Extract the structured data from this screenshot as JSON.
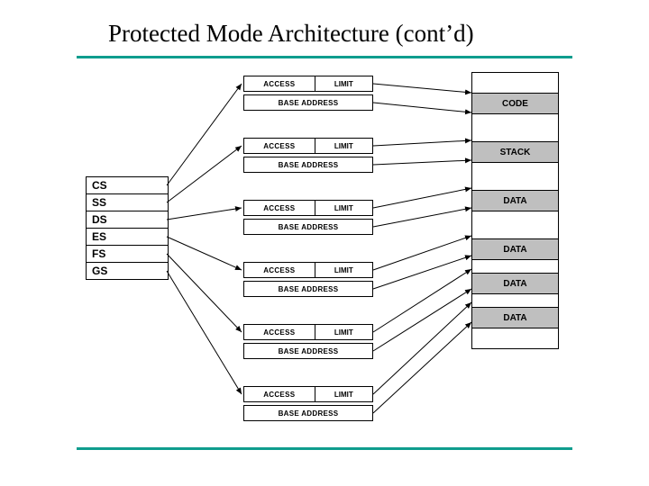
{
  "title": "Protected Mode Architecture (cont’d)",
  "registers": [
    "CS",
    "SS",
    "DS",
    "ES",
    "FS",
    "GS"
  ],
  "descriptor": {
    "access": "ACCESS",
    "limit": "LIMIT",
    "base": "BASE ADDRESS"
  },
  "memory_segments": [
    "CODE",
    "STACK",
    "DATA",
    "DATA",
    "DATA",
    "DATA"
  ]
}
